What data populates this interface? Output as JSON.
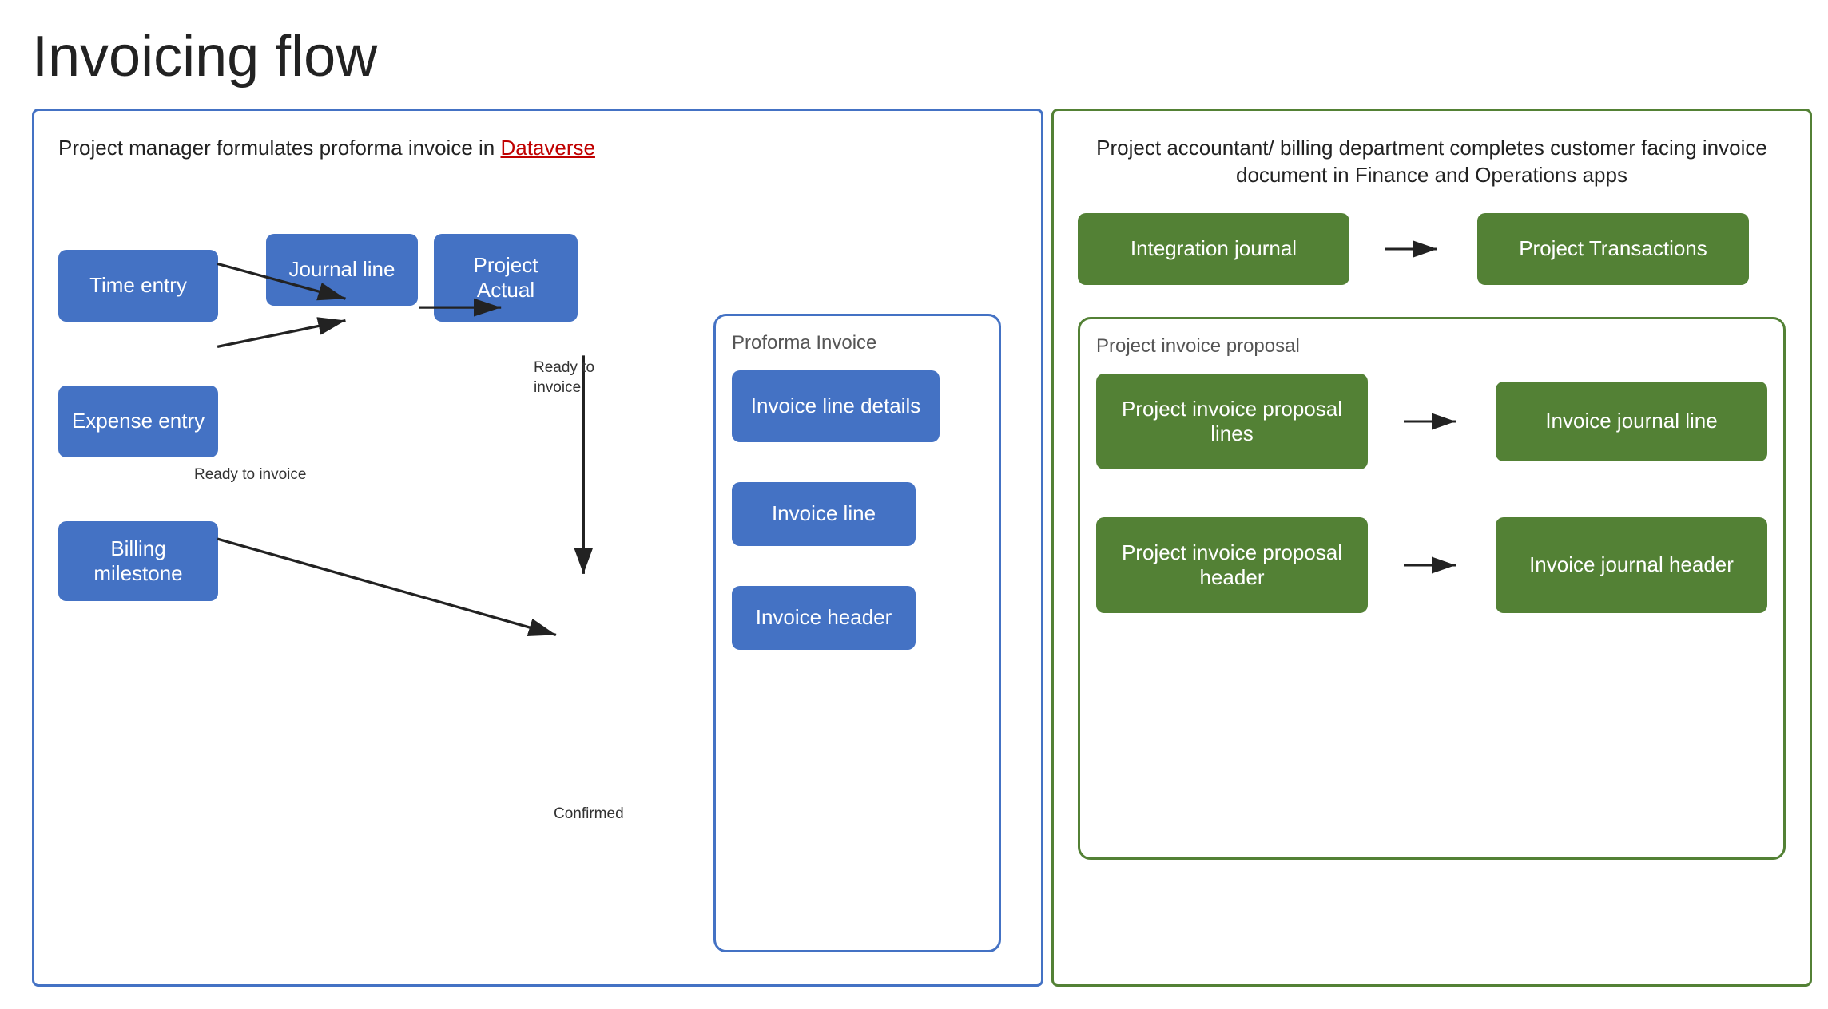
{
  "title": "Invoicing flow",
  "left_panel": {
    "label_part1": "Project manager formulates proforma invoice in ",
    "label_link": "Dataverse",
    "boxes": {
      "time_entry": "Time entry",
      "expense_entry": "Expense entry",
      "billing_milestone": "Billing milestone",
      "journal_line": "Journal line",
      "project_actual": "Project Actual",
      "invoice_line_details": "Invoice line details",
      "invoice_line": "Invoice line",
      "invoice_header": "Invoice header"
    },
    "proforma_label": "Proforma Invoice",
    "labels": {
      "ready_to_invoice1": "Ready to invoice",
      "ready_to_invoice2": "Ready to\ninvoice",
      "confirmed": "Confirmed"
    }
  },
  "right_panel": {
    "label": "Project accountant/ billing department completes customer facing invoice document in Finance and Operations apps",
    "boxes": {
      "integration_journal": "Integration journal",
      "project_transactions": "Project Transactions",
      "project_invoice_proposal_lines": "Project invoice proposal lines",
      "invoice_journal_line": "Invoice journal line",
      "project_invoice_proposal_header": "Project invoice proposal header",
      "invoice_journal_header": "Invoice journal header"
    },
    "proposal_label": "Project invoice proposal",
    "labels": {}
  }
}
